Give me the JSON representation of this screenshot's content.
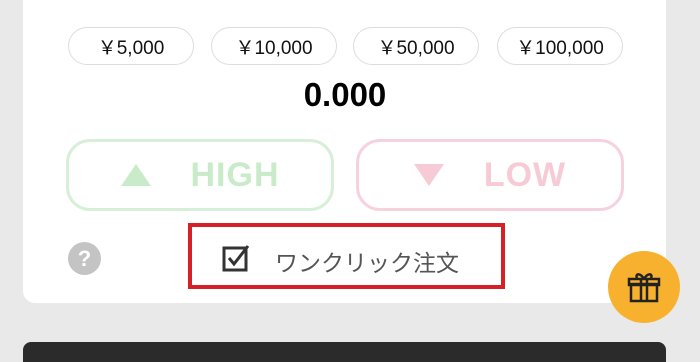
{
  "amount_chips": [
    "￥5,000",
    "￥10,000",
    "￥50,000",
    "￥100,000"
  ],
  "amount_display": "0.000",
  "buttons": {
    "high_label": "HIGH",
    "low_label": "LOW"
  },
  "help_label": "?",
  "one_click": {
    "label": "ワンクリック注文",
    "checked": true
  },
  "colors": {
    "high": "#c9ebc9",
    "low": "#f6cbd6",
    "highlight_box": "#d62027",
    "gift_button": "#f7b12f"
  },
  "icons": [
    "triangle-up-icon",
    "triangle-down-icon",
    "help-icon",
    "checkbox-icon",
    "gift-icon"
  ]
}
